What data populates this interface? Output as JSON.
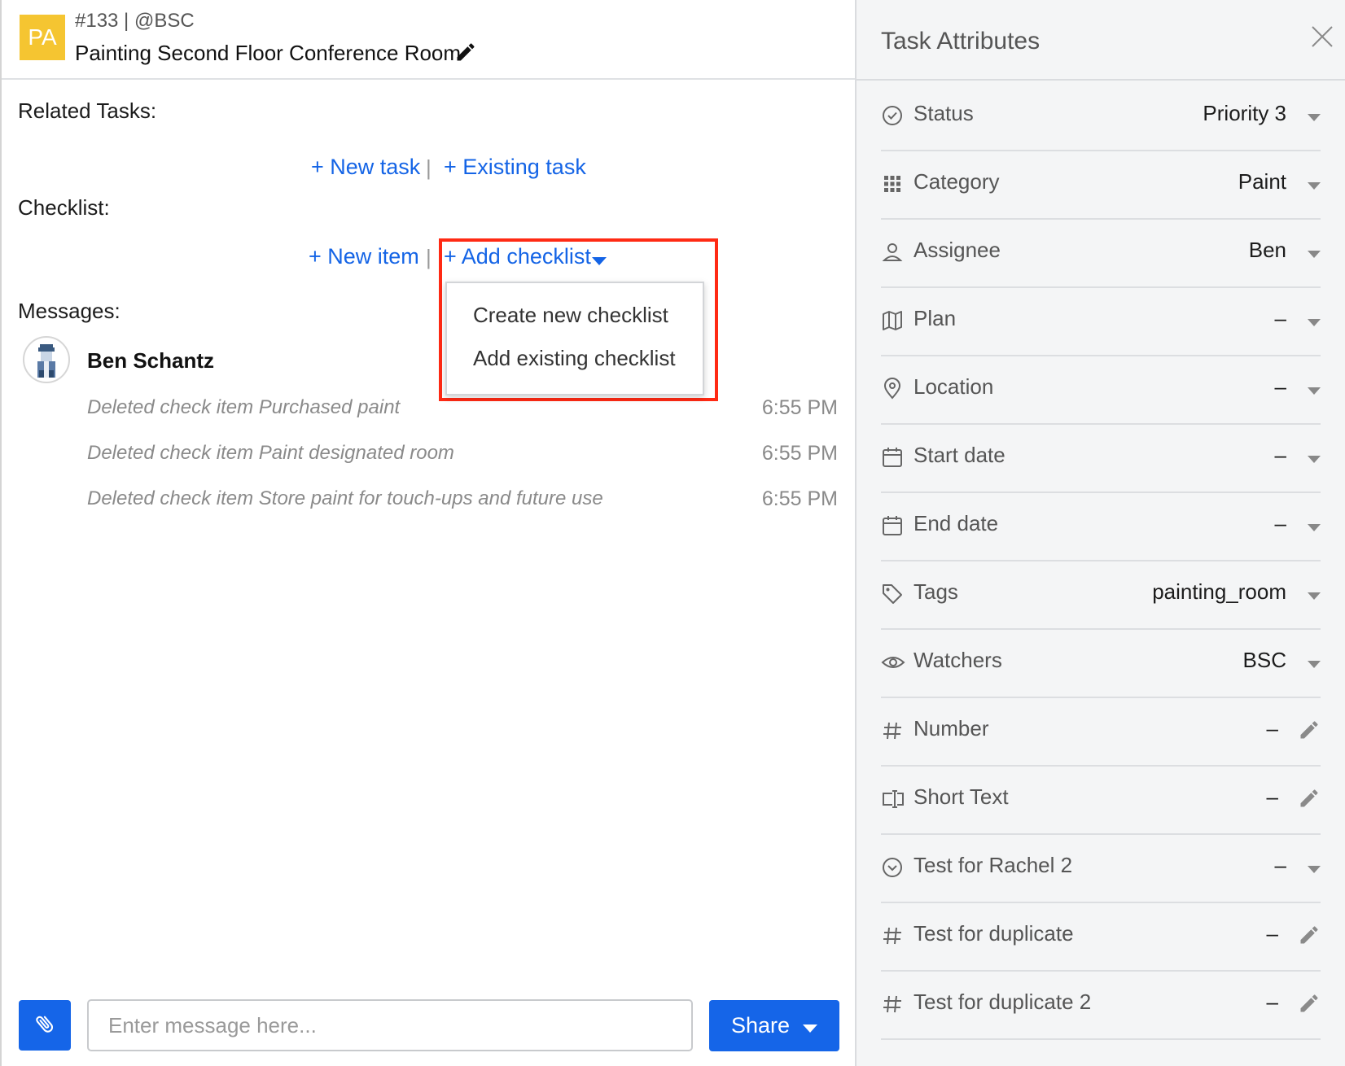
{
  "header": {
    "badge": "PA",
    "meta": "#133 | @BSC",
    "title": "Painting Second Floor Conference Room"
  },
  "related_tasks": {
    "label": "Related Tasks:",
    "new_task": "+ New task",
    "separator": "|",
    "existing_task": "+ Existing task"
  },
  "checklist": {
    "label": "Checklist:",
    "new_item": "+ New item",
    "separator": "|",
    "add_checklist": "+ Add checklist",
    "menu": [
      "Create new checklist",
      "Add existing checklist"
    ]
  },
  "messages": {
    "label": "Messages:",
    "author": "Ben Schantz",
    "items": [
      {
        "text": "Deleted check item Purchased paint",
        "time": "6:55 PM"
      },
      {
        "text": "Deleted check item Paint designated room",
        "time": "6:55 PM"
      },
      {
        "text": "Deleted check item Store paint for touch-ups and future use",
        "time": "6:55 PM"
      }
    ]
  },
  "composer": {
    "placeholder": "Enter message here...",
    "share": "Share"
  },
  "panel": {
    "title": "Task Attributes",
    "attributes": [
      {
        "icon": "check-circle-icon",
        "label": "Status",
        "value": "Priority 3",
        "control": "dropdown"
      },
      {
        "icon": "grid-icon",
        "label": "Category",
        "value": "Paint",
        "control": "dropdown"
      },
      {
        "icon": "person-icon",
        "label": "Assignee",
        "value": "Ben",
        "control": "dropdown"
      },
      {
        "icon": "map-icon",
        "label": "Plan",
        "value": "–",
        "control": "dropdown"
      },
      {
        "icon": "location-pin-icon",
        "label": "Location",
        "value": "–",
        "control": "dropdown"
      },
      {
        "icon": "calendar-icon",
        "label": "Start date",
        "value": "–",
        "control": "dropdown"
      },
      {
        "icon": "calendar-icon",
        "label": "End date",
        "value": "–",
        "control": "dropdown"
      },
      {
        "icon": "tag-icon",
        "label": "Tags",
        "value": "painting_room",
        "control": "dropdown"
      },
      {
        "icon": "eye-icon",
        "label": "Watchers",
        "value": "BSC",
        "control": "dropdown"
      },
      {
        "icon": "hash-icon",
        "label": "Number",
        "value": "–",
        "control": "edit"
      },
      {
        "icon": "text-field-icon",
        "label": "Short Text",
        "value": "–",
        "control": "edit"
      },
      {
        "icon": "chevron-circle-icon",
        "label": "Test for Rachel 2",
        "value": "–",
        "control": "dropdown"
      },
      {
        "icon": "hash-icon",
        "label": "Test for duplicate",
        "value": "–",
        "control": "edit"
      },
      {
        "icon": "hash-icon",
        "label": "Test for duplicate 2",
        "value": "–",
        "control": "edit"
      }
    ]
  },
  "colors": {
    "link": "#1464e6",
    "primary_button": "#1565e8",
    "badge": "#f5c531",
    "highlight": "#ff2a14",
    "panel_bg": "#f4f5f6"
  }
}
